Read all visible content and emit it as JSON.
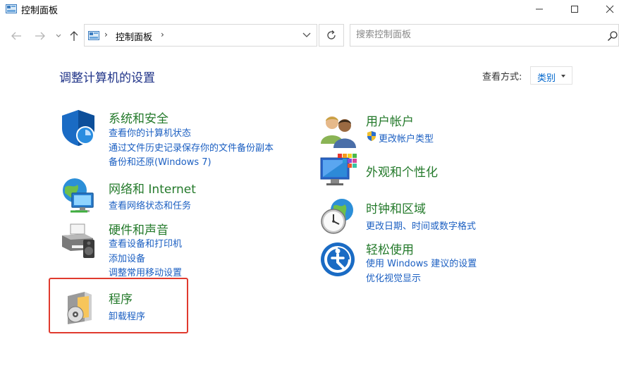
{
  "window": {
    "title": "控制面板",
    "icon": "control-panel-icon"
  },
  "address": {
    "path": "控制面板",
    "separator": "›",
    "search_placeholder": "搜索控制面板"
  },
  "header": {
    "title": "调整计算机的设置",
    "view_by_label": "查看方式:",
    "view_by_value": "类别"
  },
  "categories": [
    {
      "id": "system-security",
      "icon": "shield-icon",
      "title": "系统和安全",
      "links": [
        "查看你的计算机状态",
        "通过文件历史记录保存你的文件备份副本",
        "备份和还原(Windows 7)"
      ]
    },
    {
      "id": "network",
      "icon": "network-globe-icon",
      "title": "网络和 Internet",
      "links": [
        "查看网络状态和任务"
      ]
    },
    {
      "id": "hardware",
      "icon": "printer-icon",
      "title": "硬件和声音",
      "links": [
        "查看设备和打印机",
        "添加设备",
        "调整常用移动设置"
      ]
    },
    {
      "id": "programs",
      "icon": "programs-disc-icon",
      "title": "程序",
      "links": [
        "卸载程序"
      ]
    },
    {
      "id": "user-accounts",
      "icon": "users-icon",
      "title": "用户帐户",
      "links": [
        "更改帐户类型"
      ]
    },
    {
      "id": "appearance",
      "icon": "monitor-palette-icon",
      "title": "外观和个性化",
      "links": []
    },
    {
      "id": "clock-region",
      "icon": "clock-globe-icon",
      "title": "时钟和区域",
      "links": [
        "更改日期、时间或数字格式"
      ]
    },
    {
      "id": "ease-of-access",
      "icon": "ease-of-access-icon",
      "title": "轻松使用",
      "links": [
        "使用 Windows 建议的设置",
        "优化视觉显示"
      ]
    }
  ],
  "colors": {
    "category_title": "#247a2b",
    "link": "#1b5fc2",
    "page_title": "#1e3287",
    "highlight": "#e03a2e"
  }
}
